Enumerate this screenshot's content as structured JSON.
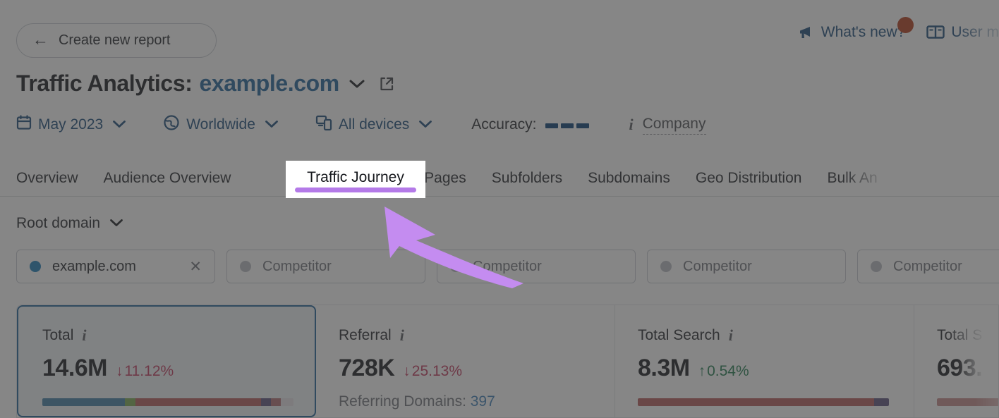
{
  "header": {
    "create_report_label": "Create new report",
    "back_arrow_icon": "arrow-left-icon",
    "whats_new_label": "What's new?",
    "whats_new_icon": "megaphone-icon",
    "user_manual_label": "User m",
    "user_manual_icon": "book-icon",
    "badge_color": "#b33a1a"
  },
  "title": {
    "prefix": "Traffic Analytics:",
    "domain": "example.com",
    "caret_icon": "chevron-down-icon",
    "external_icon": "external-link-icon"
  },
  "filters": {
    "date": {
      "label": "May 2023",
      "icon": "calendar-icon"
    },
    "location": {
      "label": "Worldwide",
      "icon": "globe-icon"
    },
    "device": {
      "label": "All devices",
      "icon": "devices-icon"
    },
    "accuracy_label": "Accuracy:",
    "accuracy_dashes": 3,
    "accuracy_color": "#073d73",
    "info_icon": "info-icon",
    "company_label": "Company"
  },
  "tabs": {
    "items": [
      {
        "label": "Overview",
        "active": false
      },
      {
        "label": "Audience Overview",
        "active": false
      },
      {
        "label": "Traffic Journey",
        "active": true
      },
      {
        "label": "Top Pages",
        "active": false
      },
      {
        "label": "Subfolders",
        "active": false
      },
      {
        "label": "Subdomains",
        "active": false
      },
      {
        "label": "Geo Distribution",
        "active": false
      },
      {
        "label": "Bulk An",
        "active": false,
        "cut": true
      }
    ],
    "active_underline_color": "#b47ae8"
  },
  "scope": {
    "label": "Root domain",
    "caret_icon": "chevron-down-icon"
  },
  "competitors": {
    "owner": {
      "label": "example.com",
      "dot_color": "#1a7cb8",
      "close_icon": "close-icon"
    },
    "placeholder": "Competitor",
    "slots": 4
  },
  "cards": [
    {
      "title": "Total",
      "value": "14.6M",
      "delta": "11.12%",
      "delta_dir": "down",
      "delta_arrow": "↓",
      "selected": true,
      "info_icon": "info-icon",
      "bar": [
        {
          "color": "#3f7ea6",
          "pct": 33
        },
        {
          "color": "#7aa84f",
          "pct": 4
        },
        {
          "color": "#b55a5a",
          "pct": 50
        },
        {
          "color": "#5b4f7d",
          "pct": 4
        },
        {
          "color": "#b06d72",
          "pct": 4
        },
        {
          "color": "#e8e2e6",
          "pct": 5
        }
      ]
    },
    {
      "title": "Referral",
      "value": "728K",
      "delta": "25.13%",
      "delta_dir": "down",
      "delta_arrow": "↓",
      "selected": false,
      "info_icon": "info-icon",
      "subline_label": "Referring Domains:",
      "subline_value": "397"
    },
    {
      "title": "Total Search",
      "value": "8.3M",
      "delta": "0.54%",
      "delta_dir": "up",
      "delta_arrow": "↑",
      "selected": false,
      "info_icon": "info-icon",
      "bar": [
        {
          "color": "#b55a5a",
          "pct": 94
        },
        {
          "color": "#5b4f7d",
          "pct": 6
        }
      ]
    },
    {
      "title": "Total S",
      "value": "693.",
      "selected": false,
      "cut": true,
      "bar": [
        {
          "color": "#c58a8a",
          "pct": 100
        }
      ]
    }
  ],
  "annotation": {
    "arrow_color": "#c48cf0",
    "arrow_name": "highlight-arrow"
  }
}
